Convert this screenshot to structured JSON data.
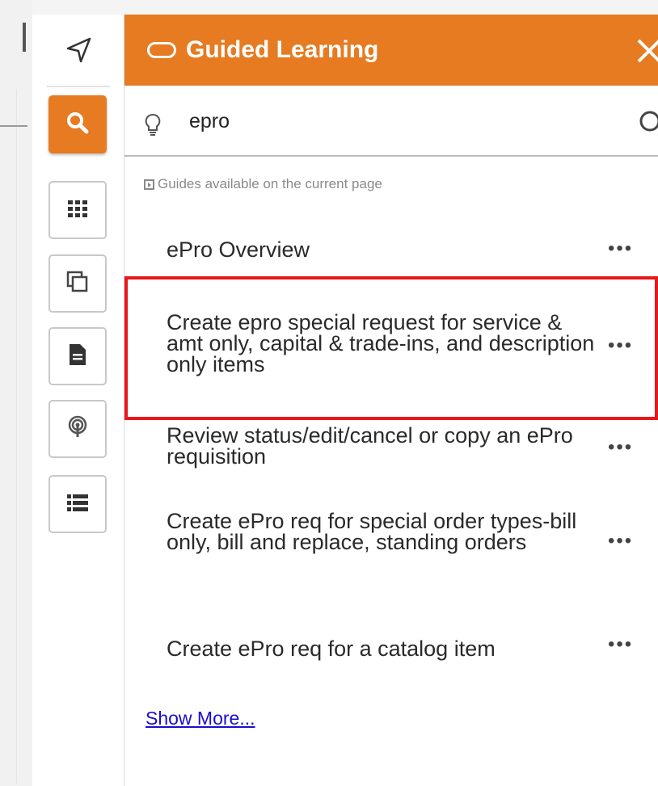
{
  "panel": {
    "title": "Guided Learning",
    "accent_color": "#e67b22",
    "highlight_color": "#e8171b"
  },
  "search": {
    "value": "epro",
    "placeholder": ""
  },
  "section_label": "Guides available on the current page",
  "guides": [
    {
      "label": "ePro Overview",
      "more": "•••"
    },
    {
      "label": "Create epro special request for service & amt only, capital & trade-ins, and description only items",
      "more": "•••"
    },
    {
      "label": "Review status/edit/cancel or copy an ePro requisition",
      "more": "•••"
    },
    {
      "label": "Create ePro req for special order types-bill only, bill and replace, standing orders",
      "more": "•••"
    },
    {
      "label": "Create ePro req for a catalog item",
      "more": "•••"
    }
  ],
  "show_more_label": "Show More...",
  "rail_icons": [
    "navigation-arrow-icon",
    "search-icon",
    "grid-icon",
    "copy-icon",
    "document-icon",
    "broadcast-icon",
    "list-icon"
  ]
}
